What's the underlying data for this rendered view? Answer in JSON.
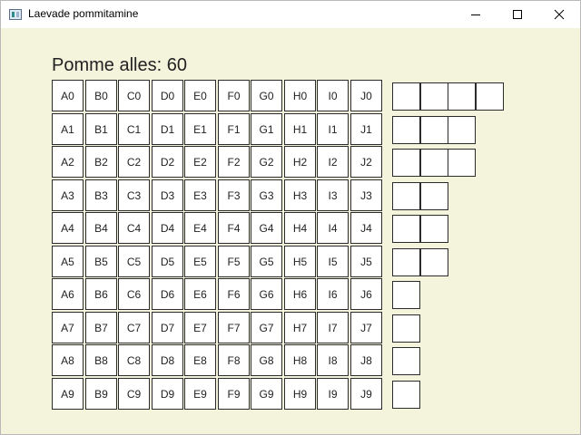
{
  "window": {
    "title": "Laevade pommitamine",
    "icons": {
      "app": "app-window-icon",
      "minimize": "minimize-icon",
      "maximize": "maximize-icon",
      "close": "close-icon"
    }
  },
  "status": {
    "text": "Pomme alles: 60"
  },
  "board": {
    "columns": [
      "A",
      "B",
      "C",
      "D",
      "E",
      "F",
      "G",
      "H",
      "I",
      "J"
    ],
    "rows": [
      "0",
      "1",
      "2",
      "3",
      "4",
      "5",
      "6",
      "7",
      "8",
      "9"
    ]
  },
  "fleet": {
    "ship_lengths": [
      4,
      3,
      3,
      2,
      2,
      2,
      1,
      1,
      1,
      1
    ]
  },
  "colors": {
    "background": "#f4f3dc",
    "cell": "#ffffff",
    "border": "#2b2b2b"
  }
}
